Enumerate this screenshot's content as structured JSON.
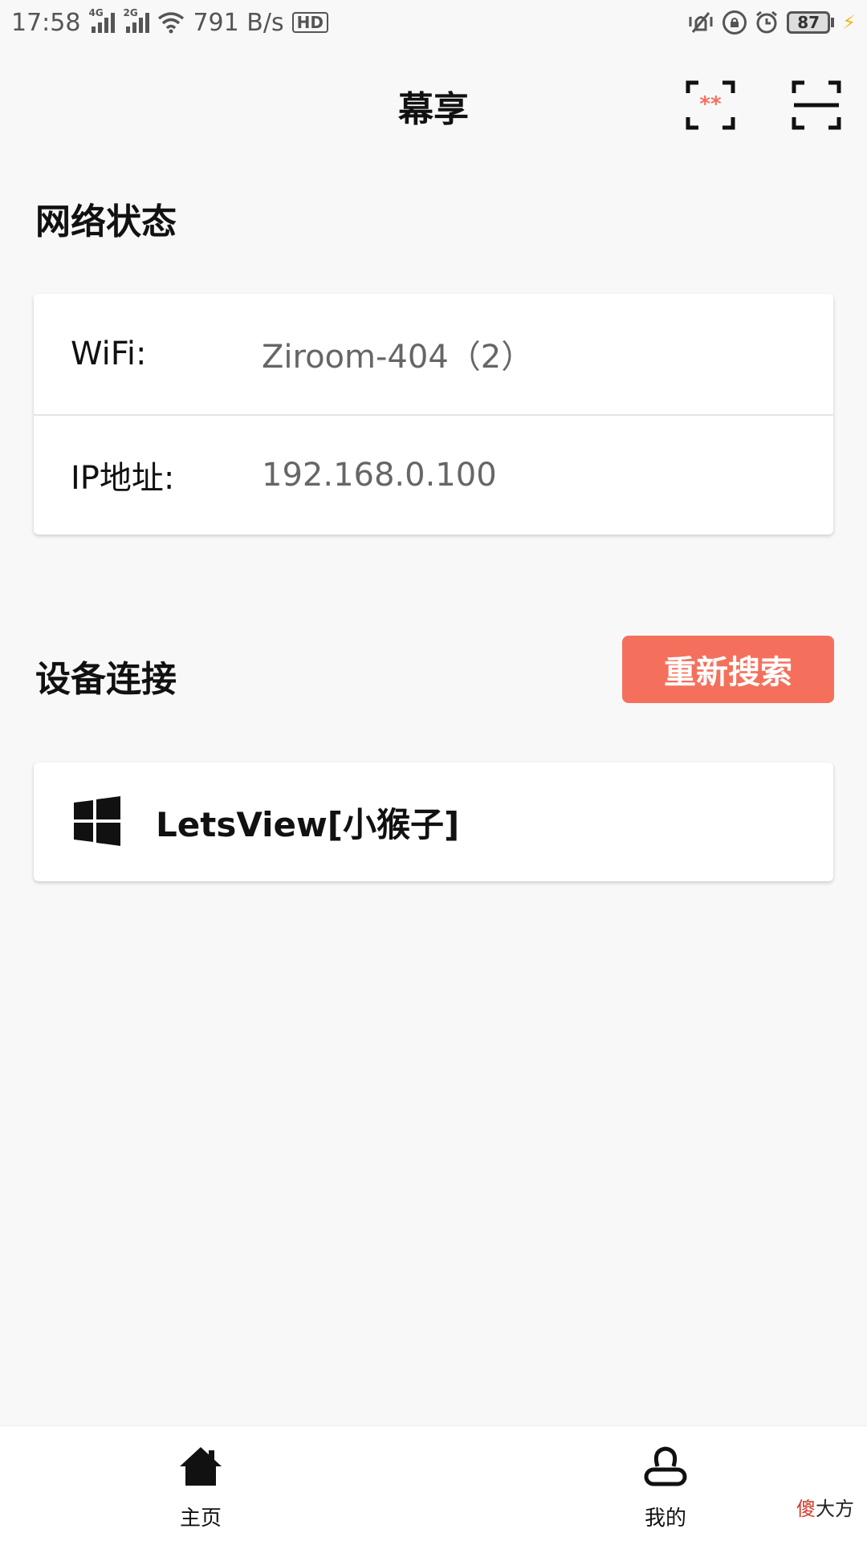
{
  "status_bar": {
    "time": "17:58",
    "sig1_label": "4G",
    "sig2_label": "2G",
    "speed": "791 B/s",
    "hd": "HD",
    "battery": "87"
  },
  "header": {
    "title": "幕享"
  },
  "network": {
    "section_title": "网络状态",
    "wifi_label": "WiFi:",
    "wifi_value": "Ziroom-404（2）",
    "ip_label": "IP地址:",
    "ip_value": "192.168.0.100"
  },
  "devices": {
    "section_title": "设备连接",
    "retry_label": "重新搜索",
    "items": [
      {
        "name": "LetsView[小猴子]",
        "icon": "windows-icon"
      }
    ]
  },
  "bottom_nav": {
    "home_label": "主页",
    "mine_label": "我的"
  },
  "watermark": {
    "accent": "傻",
    "rest": "大方"
  },
  "colors": {
    "accent": "#f5705c",
    "background": "#f8f8f8"
  }
}
